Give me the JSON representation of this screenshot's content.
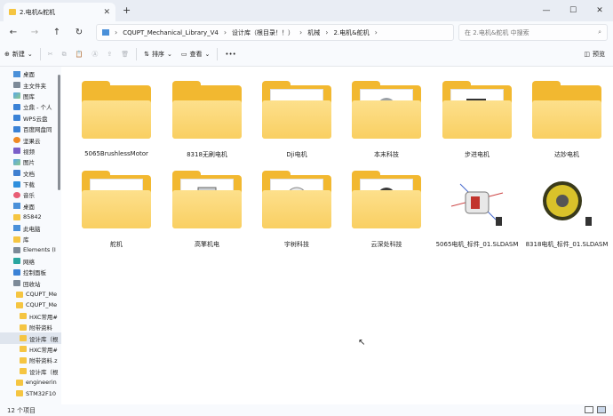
{
  "window": {
    "tab_title": "2.电机&舵机",
    "tab_close": "✕",
    "new_tab": "+",
    "min": "—",
    "max": "☐",
    "close": "✕"
  },
  "nav": {
    "back": "←",
    "forward": "→",
    "up": "↑",
    "refresh": "↻",
    "breadcrumb": [
      "CQUPT_Mechanical_Library_V4",
      "设计库（根目录！！）",
      "机械",
      "2.电机&舵机"
    ],
    "separator": "›",
    "search_placeholder": "在 2.电机&舵机 中搜索",
    "search_icon": "⌕"
  },
  "toolbar": {
    "new_label": "新建",
    "sort_label": "排序",
    "view_label": "查看",
    "more_label": "•••",
    "preview_label": "预览"
  },
  "sidebar": {
    "items": [
      {
        "label": "桌面",
        "icon": "pc"
      },
      {
        "label": "主文件夹",
        "icon": "gray"
      },
      {
        "label": "图库",
        "icon": "img"
      },
      {
        "label": "立鼎 - 个人",
        "icon": "blue"
      },
      {
        "label": "WPS云盘",
        "icon": "blue"
      },
      {
        "label": "百度网盘同",
        "icon": "blue"
      },
      {
        "label": "坚果云",
        "icon": "orange"
      },
      {
        "label": "视频",
        "icon": "video"
      },
      {
        "label": "图片",
        "icon": "img"
      },
      {
        "label": "文档",
        "icon": "doc"
      },
      {
        "label": "下载",
        "icon": "dl"
      },
      {
        "label": "音乐",
        "icon": "music"
      },
      {
        "label": "桌面",
        "icon": "pc"
      },
      {
        "label": "85842",
        "icon": "folder"
      },
      {
        "label": "此电脑",
        "icon": "pc"
      },
      {
        "label": "库",
        "icon": "folder"
      },
      {
        "label": "Elements (I",
        "icon": "gray"
      },
      {
        "label": "网络",
        "icon": "teal"
      },
      {
        "label": "控制面板",
        "icon": "blue"
      },
      {
        "label": "回收站",
        "icon": "gray"
      },
      {
        "label": "CQUPT_Me",
        "icon": "folder"
      },
      {
        "label": "CQUPT_Me",
        "icon": "folder"
      },
      {
        "label": "HXC常用#",
        "icon": "folder"
      },
      {
        "label": "附带资料",
        "icon": "folder"
      },
      {
        "label": "设计库（根",
        "icon": "folder",
        "selected": true
      },
      {
        "label": "HXC常用#",
        "icon": "folder"
      },
      {
        "label": "附带资料.z",
        "icon": "folder"
      },
      {
        "label": "设计库（根",
        "icon": "folder"
      },
      {
        "label": "engineerin",
        "icon": "folder"
      },
      {
        "label": "STM32F10",
        "icon": "folder"
      }
    ]
  },
  "files": [
    {
      "name": "5065BrushlessMotor",
      "kind": "folder"
    },
    {
      "name": "8318无刷电机",
      "kind": "folder"
    },
    {
      "name": "Dji电机",
      "kind": "folder-dji"
    },
    {
      "name": "本末科技",
      "kind": "folder-motor"
    },
    {
      "name": "步进电机",
      "kind": "folder-stepper"
    },
    {
      "name": "达妙电机",
      "kind": "folder"
    },
    {
      "name": "舵机",
      "kind": "folder-servo"
    },
    {
      "name": "高擎机电",
      "kind": "folder-gq"
    },
    {
      "name": "宇树科技",
      "kind": "folder-unitree"
    },
    {
      "name": "云深处科技",
      "kind": "folder-dp"
    },
    {
      "name": "5065电机_标件_01.SLDASM",
      "kind": "asm-5065"
    },
    {
      "name": "8318电机_标件_01.SLDASM",
      "kind": "asm-8318"
    }
  ],
  "status": {
    "count": "12 个项目"
  }
}
